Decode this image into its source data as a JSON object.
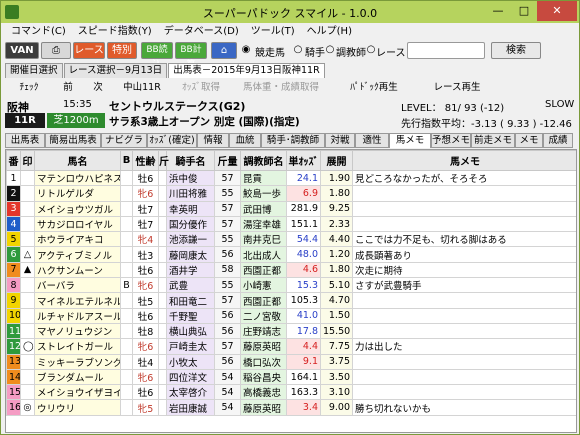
{
  "window": {
    "title": "スーパーパドック スマイル - 1.0.0",
    "min": "—",
    "max": "□",
    "close": "✕"
  },
  "menu": [
    "コマンド(C)",
    "スピード指数(Y)",
    "データベース(D)",
    "ツール(T)",
    "ヘルプ(H)"
  ],
  "toolbar": {
    "van": "VAN",
    "race": "レース",
    "special": "特別",
    "bb_read": "BB読込",
    "bb_calc": "BB計算",
    "radio_horse": "競走馬",
    "radio_jockey": "騎手",
    "radio_trainer": "調教師",
    "radio_race": "レース",
    "search_value": "",
    "search": "検索"
  },
  "tabs1": [
    "開催日選択",
    "レース選択－9月13日"
  ],
  "tab_active": "出馬表－2015年9月13日阪神11R",
  "actions": [
    "ﾁｪｯｸ",
    "前",
    "次",
    "中山11R",
    "ｵｯｽﾞ取得",
    "馬体重・成績取得",
    "ﾊﾟﾄﾞｯｸ再生",
    "レース再生"
  ],
  "race": {
    "venue": "阪神",
    "time": "15:35",
    "race_no": "11R",
    "name": "セントウルステークス(G2)",
    "course": "芝1200m",
    "cond": "サラ系3歳上オープン 別定 (国際)(指定)",
    "level": "LEVEL： 81/ 93 (-12)",
    "pace": "SLOW",
    "lead": "先行指数平均：-3.13 ( 9.33 ) -12.46"
  },
  "tabs3": [
    "出馬表",
    "簡易出馬表",
    "ナビグラフ",
    "ｵｯｽﾞ(確定)",
    "情報",
    "血統",
    "騎手･調教師",
    "対戦",
    "適性",
    "馬メモ",
    "予想メモ",
    "前走メモ",
    "メモ",
    "成績"
  ],
  "headers": [
    "番",
    "印",
    "馬名",
    "B",
    "性齢",
    "斤",
    "騎手名",
    "斤量",
    "調教師名",
    "単ｵｯｽﾞ",
    "展開",
    "馬メモ"
  ],
  "rows": [
    [
      "1",
      "",
      "マテンロウハピネス",
      "",
      "牡6",
      "",
      "浜中俊",
      "57",
      "昆貢",
      "24.1",
      "1.90",
      "見どころなかったが、そろそろ"
    ],
    [
      "2",
      "",
      "リトルゲルダ",
      "",
      "牝6",
      "",
      "川田将雅",
      "55",
      "鮫島一歩",
      "6.9",
      "1.80",
      ""
    ],
    [
      "3",
      "",
      "メイショウツガル",
      "",
      "牡7",
      "",
      "幸英明",
      "57",
      "武田博",
      "281.9",
      "9.25",
      ""
    ],
    [
      "4",
      "",
      "サカジロロイヤル",
      "",
      "牡7",
      "",
      "国分優作",
      "57",
      "湯窪幸雄",
      "151.1",
      "2.33",
      ""
    ],
    [
      "5",
      "",
      "ホウライアキコ",
      "",
      "牝4",
      "",
      "池添謙一",
      "55",
      "南井克巳",
      "54.4",
      "4.40",
      "ここでは力不足も、切れる脚はある"
    ],
    [
      "6",
      "△",
      "アクティブミノル",
      "",
      "牡3",
      "",
      "藤岡康太",
      "56",
      "北出成人",
      "48.0",
      "1.20",
      "成長顕著あり"
    ],
    [
      "7",
      "▲",
      "ハクサンムーン",
      "",
      "牡6",
      "",
      "酒井学",
      "58",
      "西園正都",
      "4.6",
      "1.80",
      "次走に期待"
    ],
    [
      "8",
      "",
      "バーバラ",
      "B",
      "牝6",
      "",
      "武豊",
      "55",
      "小崎憲",
      "15.3",
      "5.10",
      "さすが武豊騎手"
    ],
    [
      "9",
      "",
      "マイネルエテルネル",
      "",
      "牡5",
      "",
      "和田竜二",
      "57",
      "西園正都",
      "105.3",
      "4.70",
      ""
    ],
    [
      "10",
      "",
      "ルチャドルアスール",
      "",
      "牡6",
      "",
      "千野聖",
      "56",
      "二ノ宮敬",
      "41.0",
      "1.50",
      ""
    ],
    [
      "11",
      "",
      "マヤノリュウジン",
      "",
      "牡8",
      "",
      "横山典弘",
      "56",
      "庄野靖志",
      "17.8",
      "15.50",
      ""
    ],
    [
      "12",
      "◯",
      "ストレイトガール",
      "",
      "牝6",
      "",
      "戸崎圭太",
      "57",
      "藤原英昭",
      "4.4",
      "7.75",
      "力は出した"
    ],
    [
      "13",
      "",
      "ミッキーラブソング",
      "",
      "牡4",
      "",
      "小牧太",
      "56",
      "橋口弘次",
      "9.1",
      "3.75",
      ""
    ],
    [
      "14",
      "",
      "ブランダムール",
      "",
      "牝6",
      "",
      "四位洋文",
      "54",
      "稲谷昌央",
      "164.1",
      "3.50",
      ""
    ],
    [
      "15",
      "",
      "メイショウイザヨイ",
      "",
      "牡6",
      "",
      "太宰啓介",
      "54",
      "高橋義忠",
      "163.3",
      "3.10",
      ""
    ],
    [
      "16",
      "◎",
      "ウリウリ",
      "",
      "牝5",
      "",
      "岩田康誠",
      "54",
      "藤原英昭",
      "3.4",
      "9.00",
      "勝ち切れないかも"
    ]
  ],
  "colors": {
    "title": "#b6d35e",
    "gate": [
      "#ffffff",
      "#000000",
      "#e4362b",
      "#1f5ec9",
      "#f2d400",
      "#2f9a3c",
      "#f08c1e",
      "#f59cc4"
    ]
  }
}
